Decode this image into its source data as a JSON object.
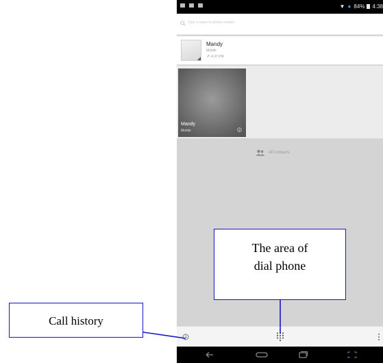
{
  "status_bar": {
    "battery": "84%",
    "time": "4:38"
  },
  "search": {
    "placeholder": "Type a name or phone number"
  },
  "recent": {
    "name": "Mandy",
    "type": "Mobile",
    "time": "4:37 PM"
  },
  "favorite": {
    "name": "Mandy",
    "type": "Mobile"
  },
  "all_contacts": {
    "label": "All contacts"
  },
  "annotations": {
    "call_history": "Call history",
    "dial_line1": "The area of",
    "dial_line2": "dial phone"
  },
  "colors": {
    "annotation_border": "#1515c8",
    "status_bar": "#000000",
    "signal": "#33b5e5",
    "outgoing_call": "#4caf50"
  },
  "icons": {
    "history": "clock-icon",
    "dialpad": "dialpad-icon",
    "overflow": "more-vert-icon",
    "all_contacts": "contacts-icon"
  }
}
